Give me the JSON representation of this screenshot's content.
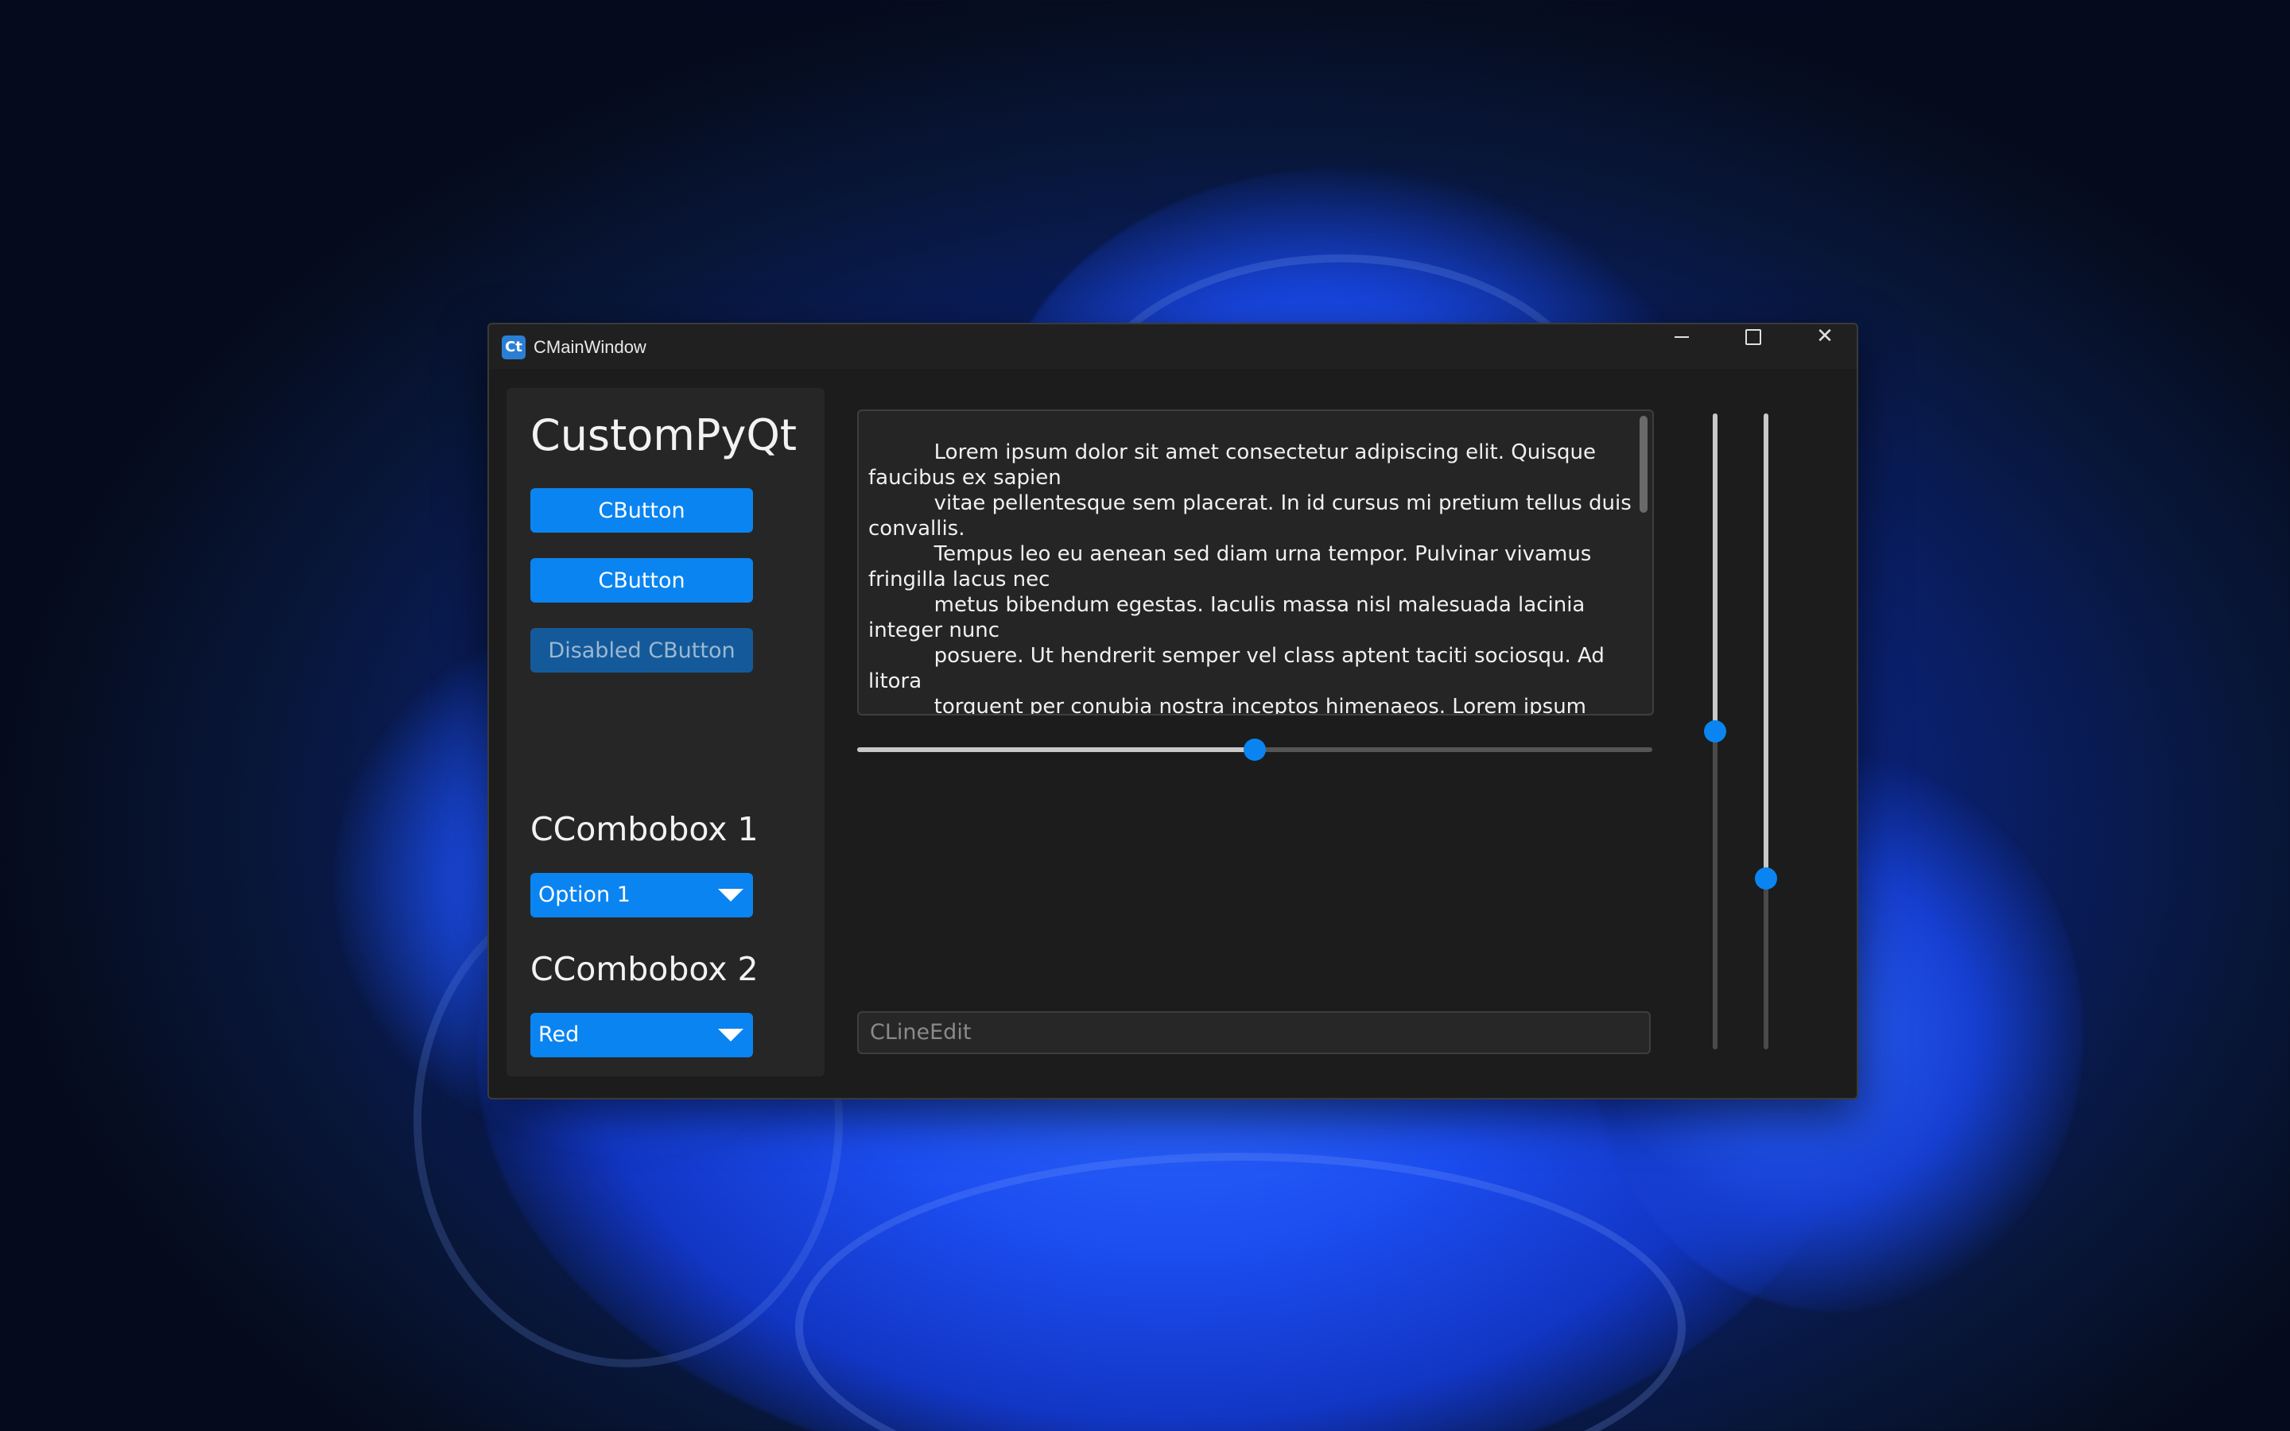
{
  "window": {
    "title": "CMainWindow",
    "app_icon_text": "Ct",
    "icons": [
      "minimize-icon",
      "maximize-icon",
      "close-icon"
    ]
  },
  "left_panel": {
    "heading": "CustomPyQt",
    "buttons": [
      {
        "label": "CButton",
        "enabled": true
      },
      {
        "label": "CButton",
        "enabled": true
      },
      {
        "label": "Disabled CButton",
        "enabled": false
      }
    ],
    "combo1": {
      "heading": "CCombobox 1",
      "selected": "Option 1"
    },
    "combo2": {
      "heading": "CCombobox 2",
      "selected": "Red"
    }
  },
  "textedit": {
    "content": "          Lorem ipsum dolor sit amet consectetur adipiscing elit. Quisque faucibus ex sapien\n          vitae pellentesque sem placerat. In id cursus mi pretium tellus duis convallis.\n          Tempus leo eu aenean sed diam urna tempor. Pulvinar vivamus fringilla lacus nec\n          metus bibendum egestas. Iaculis massa nisl malesuada lacinia integer nunc\n          posuere. Ut hendrerit semper vel class aptent taciti sociosqu. Ad litora\n          torquent per conubia nostra inceptos himenaeos. Lorem ipsum"
  },
  "sliders": {
    "horizontal_value": 0.5,
    "vertical1_value": 0.5,
    "vertical2_value": 0.26
  },
  "lineedit": {
    "placeholder": "CLineEdit",
    "value": ""
  },
  "colors": {
    "accent": "#0a84f0",
    "disabled_accent": "#145a9a",
    "window_bg": "#1c1c1c",
    "panel_bg": "#262626"
  }
}
